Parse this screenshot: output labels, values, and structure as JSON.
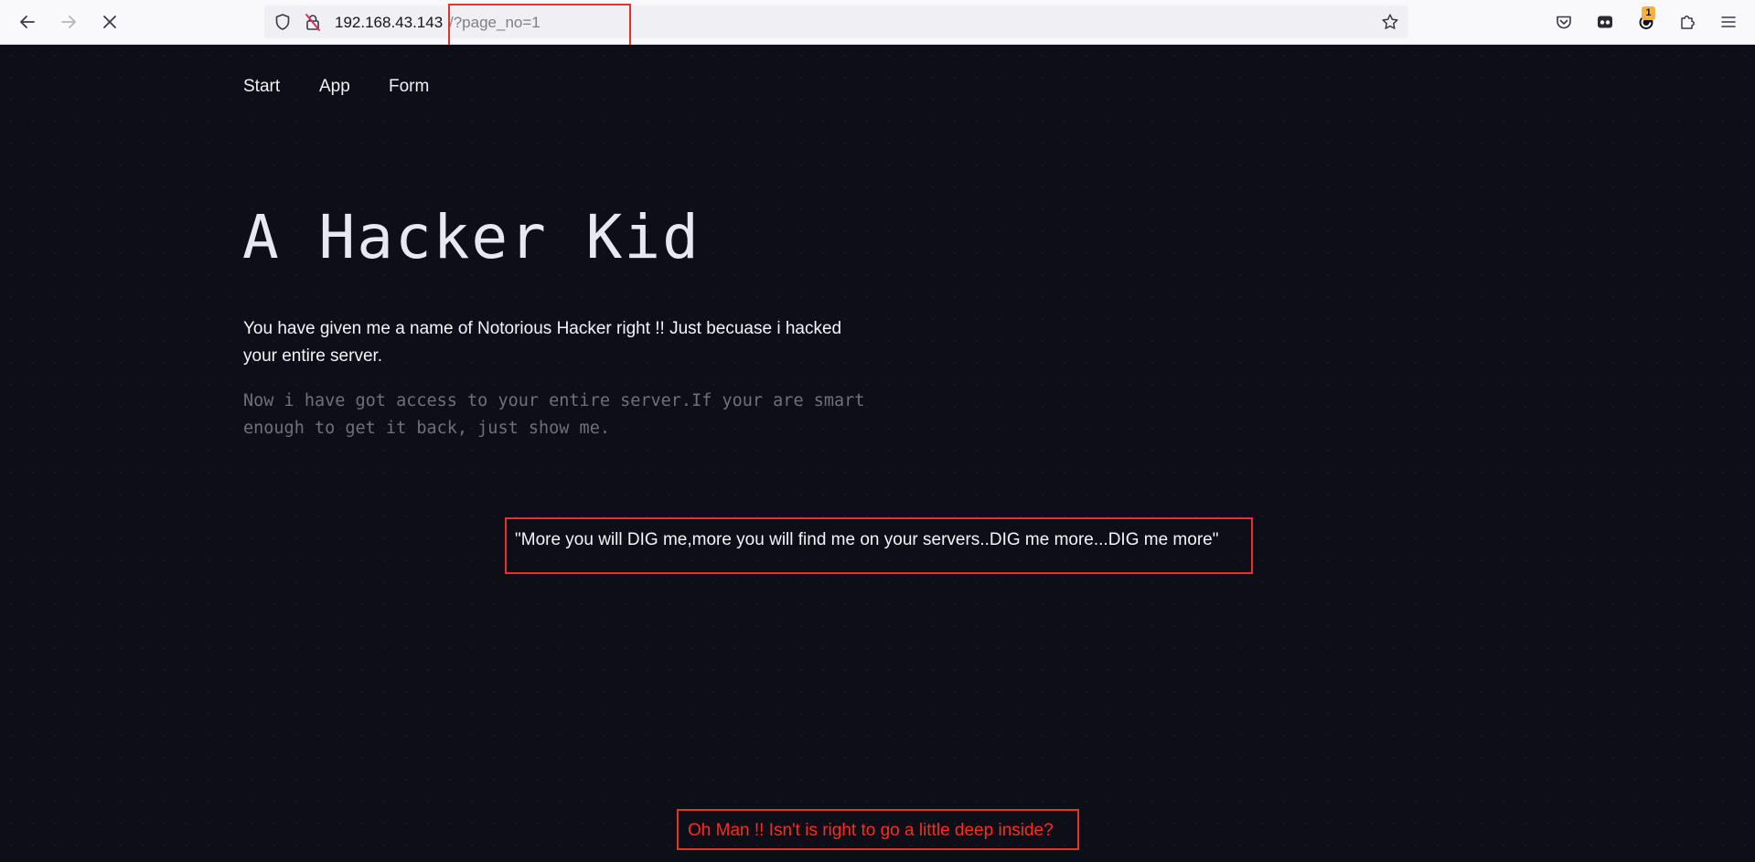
{
  "browser": {
    "url_host": "192.168.43.143",
    "url_path": "/?page_no=1",
    "extension_badge_count": "1",
    "accent_color": "#e6332a"
  },
  "icons": {
    "back": "back-arrow-icon",
    "forward": "forward-arrow-icon",
    "stop": "stop-loading-icon",
    "tracking": "shield-icon",
    "insecure": "insecure-lock-icon",
    "bookmark": "star-icon",
    "pocket": "pocket-icon",
    "container": "container-icon",
    "extension": "extension-badge-icon",
    "extensions": "puzzle-icon",
    "menu": "hamburger-menu-icon"
  },
  "nav": {
    "items": [
      "Start",
      "App",
      "Form"
    ]
  },
  "hero": {
    "title": "A Hacker Kid",
    "lead": "You have given me a name of Notorious Hacker right !! Just becuase i hacked your entire server.",
    "note": "Now i have got access to your entire server.If your are smart enough to get it back, just show me."
  },
  "quote": "\"More you will DIG me,more you will find me on your servers..DIG me more...DIG me more\"",
  "hint": "Oh Man !! Isn't is right to go a little deep inside?",
  "colors": {
    "page_background": "#0d0e17",
    "hint_text": "#ff2a1f"
  }
}
